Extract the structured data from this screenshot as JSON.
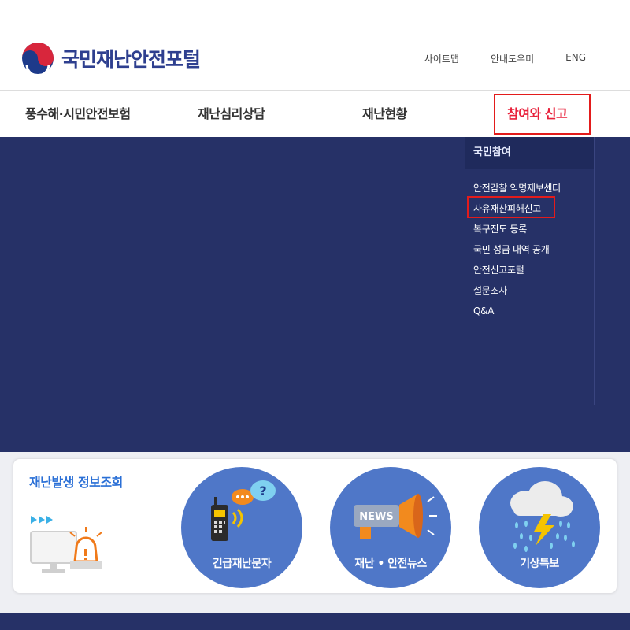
{
  "header": {
    "logo_text": "국민재난안전포털",
    "utility_links": [
      "사이트맵",
      "안내도우미",
      "ENG"
    ]
  },
  "nav": {
    "items": [
      "풍수해·시민안전보험",
      "재난심리상담",
      "재난현황",
      "참여와 신고"
    ],
    "active_index": 3
  },
  "dropdown": {
    "heading": "국민참여",
    "items": [
      "안전감찰 익명제보센터",
      "사유재산피해신고",
      "복구진도 등록",
      "국민 성금 내역 공개",
      "안전신고포털",
      "설문조사",
      "Q&A"
    ],
    "highlighted_index": 1
  },
  "info_panel": {
    "title": "재난발생 정보조회",
    "circles": [
      {
        "label": "긴급재난문자",
        "icon": "walkie-talkie-icon"
      },
      {
        "label": "재난 • 안전뉴스",
        "icon": "megaphone-news-icon",
        "badge": "NEWS"
      },
      {
        "label": "기상특보",
        "icon": "storm-cloud-icon"
      }
    ]
  },
  "colors": {
    "brand_blue": "#263167",
    "accent_red": "#e8203a",
    "circle_blue": "#4f77c8",
    "title_blue": "#2a6fd6"
  }
}
